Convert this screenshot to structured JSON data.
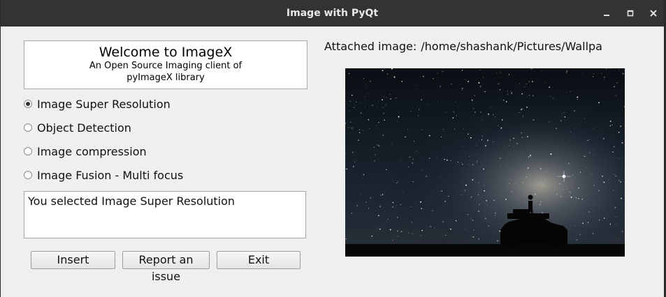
{
  "window": {
    "title": "Image with PyQt"
  },
  "welcome": {
    "heading": "Welcome to ImageX",
    "subtitle_line1": "An Open Source Imaging client of",
    "subtitle_line2": "pyImageX library"
  },
  "options": [
    {
      "label": "Image Super Resolution",
      "checked": true
    },
    {
      "label": "Object Detection",
      "checked": false
    },
    {
      "label": "Image compression",
      "checked": false
    },
    {
      "label": "Image Fusion - Multi focus",
      "checked": false
    }
  ],
  "output": {
    "text": "You selected Image Super Resolution"
  },
  "buttons": {
    "insert": "Insert",
    "report": "Report an issue",
    "exit": "Exit"
  },
  "attached": {
    "label": "Attached image:",
    "path": "/home/shashank/Pictures/Wallpa"
  },
  "icons": {
    "minimize": "minimize-icon",
    "maximize": "maximize-icon",
    "close": "close-icon"
  },
  "colors": {
    "titlebar": "#333333",
    "window_bg": "#efefef"
  }
}
